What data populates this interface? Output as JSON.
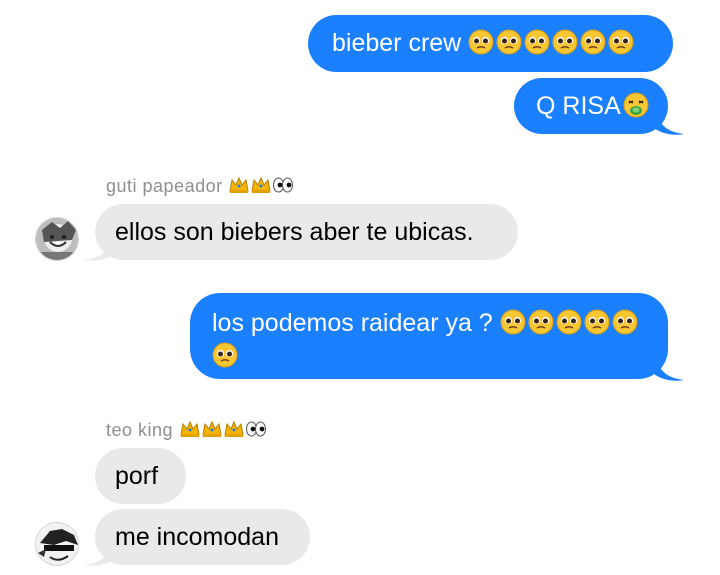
{
  "messages": {
    "m1": {
      "text": "bieber crew ",
      "emojis": [
        "pleading-face-emoji",
        "pleading-face-emoji",
        "pleading-face-emoji",
        "pleading-face-emoji",
        "pleading-face-emoji",
        "pleading-face-emoji"
      ]
    },
    "m2": {
      "text": "Q RISA",
      "emojis": [
        "nauseated-face-emoji"
      ]
    },
    "sender1": {
      "name": "guti papeador",
      "emojis": [
        "crown-emoji",
        "crown-emoji",
        "eyes-emoji"
      ]
    },
    "m3": {
      "text": "ellos son biebers aber te ubicas."
    },
    "m4": {
      "text": "los podemos raidear ya ? ",
      "emojis_line1": [
        "pleading-face-emoji",
        "pleading-face-emoji",
        "pleading-face-emoji",
        "pleading-face-emoji",
        "pleading-face-emoji"
      ],
      "emojis_line2": [
        "pleading-face-emoji"
      ]
    },
    "sender2": {
      "name": "teo king",
      "emojis": [
        "crown-emoji",
        "crown-emoji",
        "crown-emoji",
        "eyes-emoji"
      ]
    },
    "m5": {
      "text": "porf"
    },
    "m6": {
      "text": "me incomodan"
    }
  },
  "colors": {
    "sent_bubble": "#1a80ff",
    "received_bubble": "#e9e9eb",
    "sender_name": "#8e8e93"
  }
}
